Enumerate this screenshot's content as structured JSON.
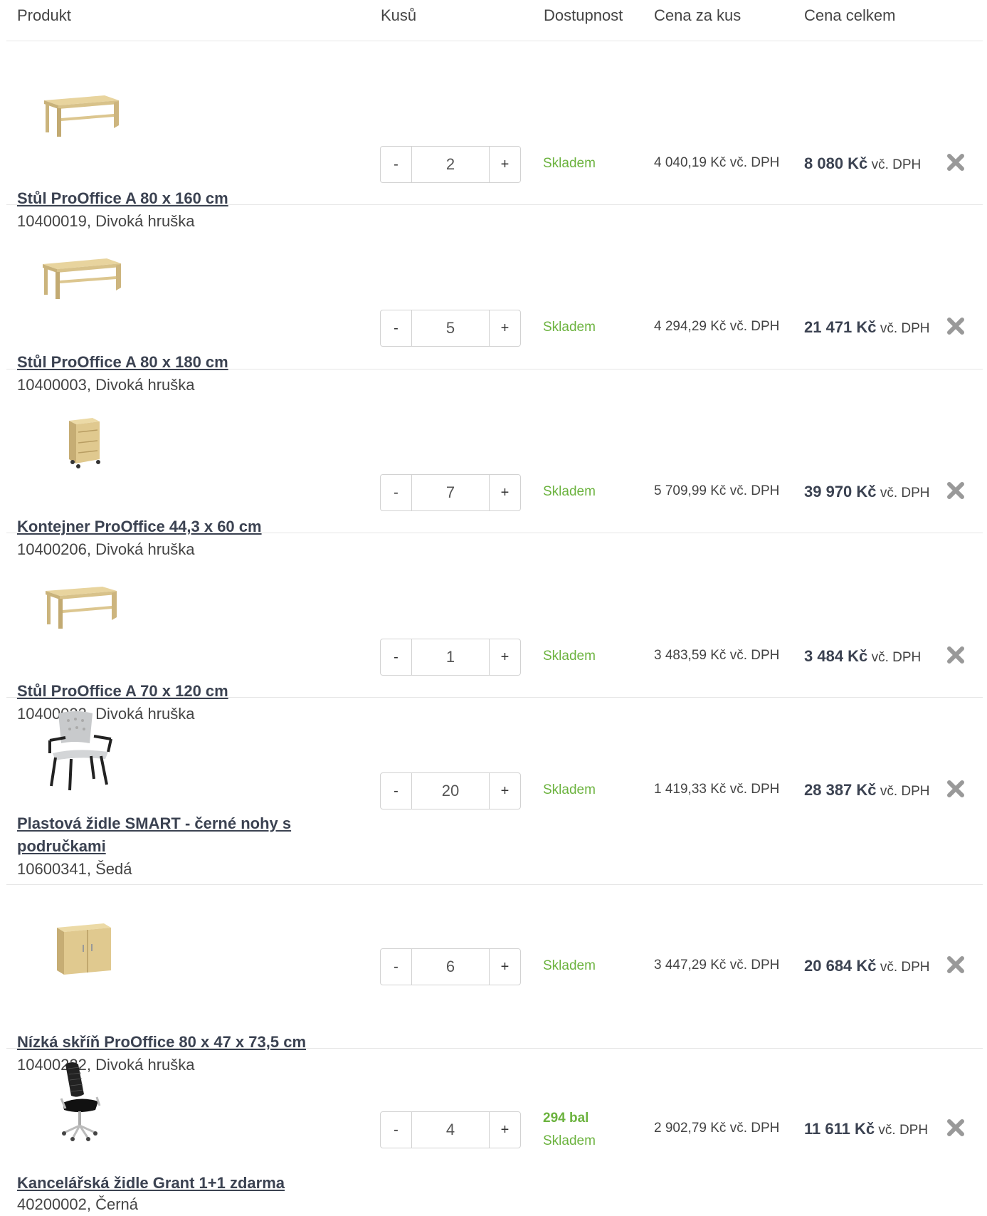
{
  "header": {
    "product": "Produkt",
    "qty": "Kusů",
    "availability": "Dostupnost",
    "unit_price": "Cena za kus",
    "total_price": "Cena celkem"
  },
  "controls": {
    "minus": "-",
    "plus": "+",
    "remove_icon": "close-icon"
  },
  "colors": {
    "in_stock": "#6cb33f",
    "link": "#3b4251",
    "divider": "#e6e6e6",
    "remove": "#999999"
  },
  "items": [
    {
      "name": "Stůl ProOffice A 80 x 160 cm",
      "meta": "10400019, Divoká hruška",
      "qty": "2",
      "stock_extra": "",
      "stock": "Skladem",
      "unit_price": "4 040,19 Kč vč. DPH",
      "total": "8 080 Kč",
      "total_suffix": "vč. DPH",
      "image": "desk"
    },
    {
      "name": "Stůl ProOffice A 80 x 180 cm",
      "meta": "10400003, Divoká hruška",
      "qty": "5",
      "stock_extra": "",
      "stock": "Skladem",
      "unit_price": "4 294,29 Kč vč. DPH",
      "total": "21 471 Kč",
      "total_suffix": "vč. DPH",
      "image": "desk"
    },
    {
      "name": "Kontejner ProOffice 44,3 x 60 cm",
      "meta": "10400206, Divoká hruška",
      "qty": "7",
      "stock_extra": "",
      "stock": "Skladem",
      "unit_price": "5 709,99 Kč vč. DPH",
      "total": "39 970 Kč",
      "total_suffix": "vč. DPH",
      "image": "container"
    },
    {
      "name": "Stůl ProOffice A 70 x 120 cm",
      "meta": "10400023, Divoká hruška",
      "qty": "1",
      "stock_extra": "",
      "stock": "Skladem",
      "unit_price": "3 483,59 Kč vč. DPH",
      "total": "3 484 Kč",
      "total_suffix": "vč. DPH",
      "image": "desk"
    },
    {
      "name": "Plastová židle SMART - černé nohy s područkami",
      "meta": "10600341, Šedá",
      "qty": "20",
      "stock_extra": "",
      "stock": "Skladem",
      "unit_price": "1 419,33 Kč vč. DPH",
      "total": "28 387 Kč",
      "total_suffix": "vč. DPH",
      "image": "chair"
    },
    {
      "name": "Nízká skříň ProOffice 80 x 47 x 73,5 cm",
      "meta": "10400222, Divoká hruška",
      "qty": "6",
      "stock_extra": "",
      "stock": "Skladem",
      "unit_price": "3 447,29 Kč vč. DPH",
      "total": "20 684 Kč",
      "total_suffix": "vč. DPH",
      "image": "cabinet"
    },
    {
      "name": "Kancelářská židle Grant 1+1 zdarma",
      "meta": "40200002, Černá",
      "qty": "4",
      "stock_extra": "294 bal",
      "stock": "Skladem",
      "unit_price": "2 902,79 Kč vč. DPH",
      "total": "11 611 Kč",
      "total_suffix": "vč. DPH",
      "image": "office-chair"
    }
  ]
}
